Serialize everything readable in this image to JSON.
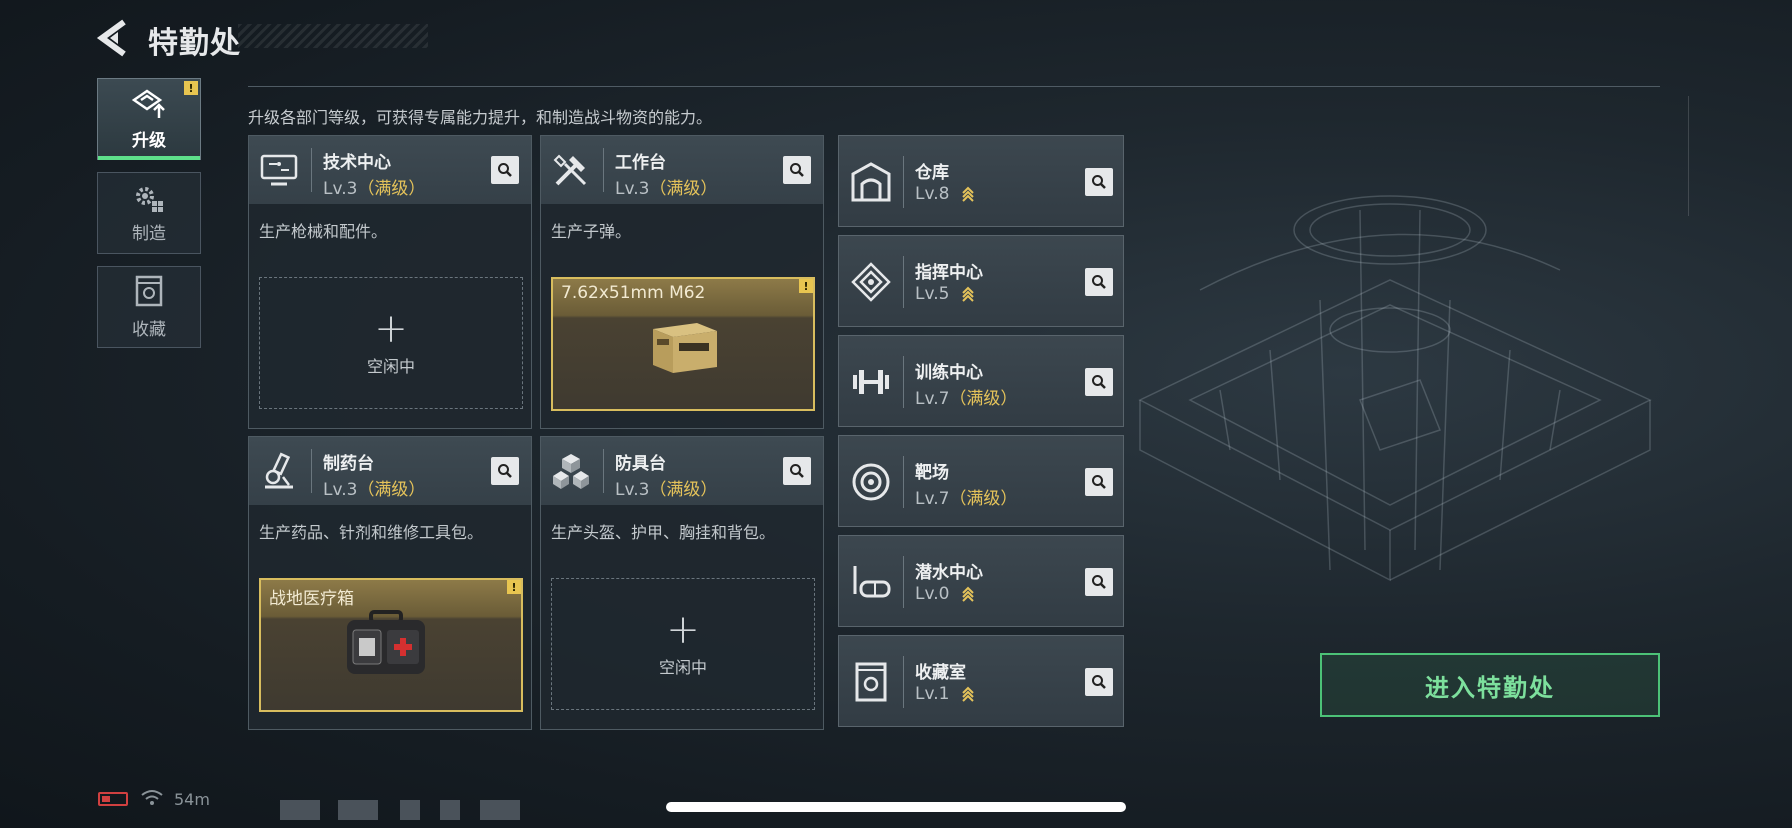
{
  "header": {
    "title": "特勤处"
  },
  "side_tabs": [
    {
      "label": "升级",
      "icon": "upgrade-icon",
      "active": true,
      "badge": "!"
    },
    {
      "label": "制造",
      "icon": "gears-icon",
      "active": false
    },
    {
      "label": "收藏",
      "icon": "collection-icon",
      "active": false
    }
  ],
  "description": "升级各部门等级，可获得专属能力提升，和制造战斗物资的能力。",
  "departments": [
    {
      "name": "技术中心",
      "level": "Lv.3",
      "max_tag": "（满级）",
      "desc": "生产枪械和配件。",
      "status": "空闲中",
      "icon": "computer-icon"
    },
    {
      "name": "工作台",
      "level": "Lv.3",
      "max_tag": "（满级）",
      "desc": "生产子弹。",
      "product": "7.62x51mm M62",
      "badge": "!",
      "icon": "tools-icon"
    },
    {
      "name": "制药台",
      "level": "Lv.3",
      "max_tag": "（满级）",
      "desc": "生产药品、针剂和维修工具包。",
      "product": "战地医疗箱",
      "badge": "!",
      "icon": "microscope-icon"
    },
    {
      "name": "防具台",
      "level": "Lv.3",
      "max_tag": "（满级）",
      "desc": "生产头盔、护甲、胸挂和背包。",
      "status": "空闲中",
      "icon": "armor-cubes-icon"
    }
  ],
  "facilities": [
    {
      "name": "仓库",
      "level": "Lv.8",
      "upgradable": true,
      "icon": "warehouse-icon"
    },
    {
      "name": "指挥中心",
      "level": "Lv.5",
      "upgradable": true,
      "icon": "command-icon"
    },
    {
      "name": "训练中心",
      "level": "Lv.7",
      "max_tag": "（满级）",
      "icon": "dumbbell-icon"
    },
    {
      "name": "靶场",
      "level": "Lv.7",
      "max_tag": "（满级）",
      "icon": "target-icon"
    },
    {
      "name": "潜水中心",
      "level": "Lv.0",
      "upgradable": true,
      "icon": "diving-mask-icon"
    },
    {
      "name": "收藏室",
      "level": "Lv.1",
      "upgradable": true,
      "icon": "collection-room-icon"
    }
  ],
  "enter_button": "进入特勤处",
  "status_bar": {
    "ping": "54m"
  },
  "colors": {
    "accent_green": "#5ee08a",
    "max_level_gold": "#e5c35a",
    "warning_yellow": "#e8c550"
  }
}
